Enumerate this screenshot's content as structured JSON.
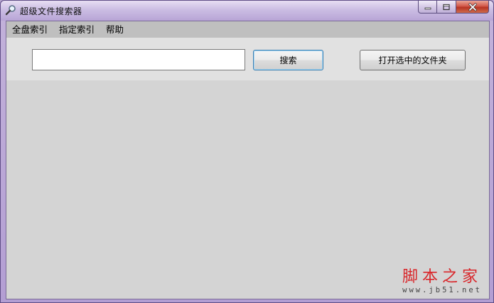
{
  "window": {
    "title": "超级文件搜索器",
    "icon": "magnifier-icon",
    "controls": [
      "minimize-icon",
      "maximize-icon",
      "close-icon"
    ]
  },
  "menu": {
    "items": [
      "全盘索引",
      "指定索引",
      "帮助"
    ]
  },
  "toolbar": {
    "search_value": "",
    "search_button": "搜索",
    "open_folder_button": "打开选中的文件夹"
  },
  "watermark": {
    "main": "脚本之家",
    "sub": "www.jb51.net"
  },
  "colors": {
    "client_bg": "#d4d4d4",
    "menubar_bg": "#bfbfbf",
    "toolbar_bg": "#e1e1e1",
    "watermark_red": "#d9262a",
    "close_red": "#c9463a"
  }
}
